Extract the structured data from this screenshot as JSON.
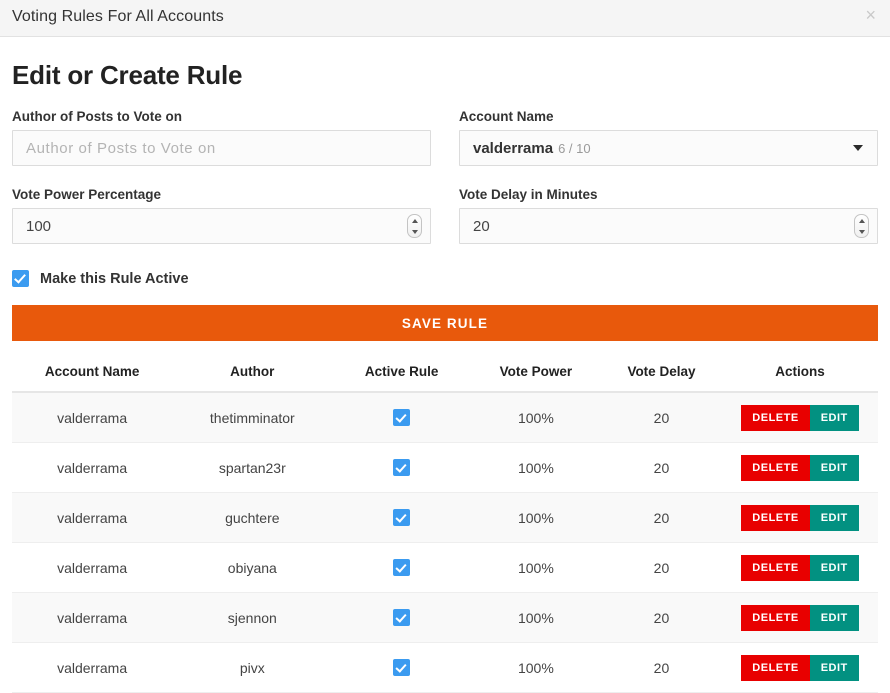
{
  "modal": {
    "title": "Voting Rules For All Accounts",
    "close_icon": "close-icon",
    "close_glyph": "×"
  },
  "section": {
    "heading": "Edit or Create Rule"
  },
  "form": {
    "author_field": {
      "label": "Author of Posts to Vote on",
      "value": "",
      "placeholder": "Author of Posts to Vote on"
    },
    "account_select": {
      "label": "Account Name",
      "selected": "valderrama",
      "counter": "6 / 10",
      "caret_icon": "chevron-down-icon"
    },
    "vote_power_field": {
      "label": "Vote Power Percentage",
      "value": "100",
      "spinner_icon": "spinner-arrows-icon"
    },
    "vote_delay_field": {
      "label": "Vote Delay in Minutes",
      "value": "20",
      "spinner_icon": "spinner-arrows-icon"
    },
    "active_checkbox": {
      "label": "Make this Rule Active",
      "checked": true,
      "icon": "checkmark-icon"
    },
    "save_button": {
      "label": "SAVE RULE"
    }
  },
  "table": {
    "columns": [
      "Account Name",
      "Author",
      "Active Rule",
      "Vote Power",
      "Vote Delay",
      "Actions"
    ],
    "row_actions": {
      "delete_label": "DELETE",
      "edit_label": "EDIT"
    },
    "rows": [
      {
        "account": "valderrama",
        "author": "thetimminator",
        "active": true,
        "power": "100%",
        "delay": "20"
      },
      {
        "account": "valderrama",
        "author": "spartan23r",
        "active": true,
        "power": "100%",
        "delay": "20"
      },
      {
        "account": "valderrama",
        "author": "guchtere",
        "active": true,
        "power": "100%",
        "delay": "20"
      },
      {
        "account": "valderrama",
        "author": "obiyana",
        "active": true,
        "power": "100%",
        "delay": "20"
      },
      {
        "account": "valderrama",
        "author": "sjennon",
        "active": true,
        "power": "100%",
        "delay": "20"
      },
      {
        "account": "valderrama",
        "author": "pivx",
        "active": true,
        "power": "100%",
        "delay": "20"
      }
    ]
  },
  "colors": {
    "save_button": "#e8590c",
    "delete_button": "#e80000",
    "edit_button": "#029181",
    "checkbox": "#3b9bf0",
    "header_bg": "#f5f5f5",
    "row_stripe": "#f9f9f9"
  }
}
